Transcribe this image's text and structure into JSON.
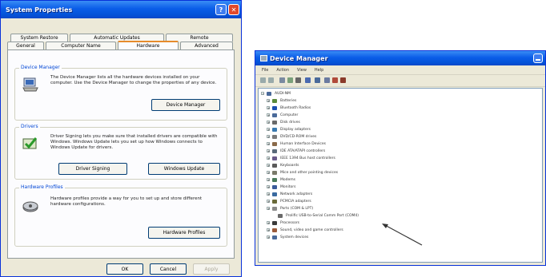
{
  "system_properties": {
    "title": "System Properties",
    "help_glyph": "?",
    "close_glyph": "✕",
    "tabs_row1": [
      "System Restore",
      "Automatic Updates",
      "Remote"
    ],
    "tabs_row2": [
      "General",
      "Computer Name",
      "Hardware",
      "Advanced"
    ],
    "active_tab": "Hardware",
    "device_manager": {
      "heading": "Device Manager",
      "text": "The Device Manager lists all the hardware devices installed on your computer. Use the Device Manager to change the properties of any device.",
      "button": "Device Manager",
      "icon": "computer-icon"
    },
    "drivers": {
      "heading": "Drivers",
      "text": "Driver Signing lets you make sure that installed drivers are compatible with Windows. Windows Update lets you set up how Windows connects to Windows Update for drivers.",
      "button_signing": "Driver Signing",
      "button_update": "Windows Update",
      "icon": "driver-check-icon"
    },
    "hardware_profiles": {
      "heading": "Hardware Profiles",
      "text": "Hardware profiles provide a way for you to set up and store different hardware configurations.",
      "button": "Hardware Profiles",
      "icon": "hardware-profile-icon"
    },
    "footer": {
      "ok": "OK",
      "cancel": "Cancel",
      "apply": "Apply"
    }
  },
  "device_manager_window": {
    "title": "Device Manager",
    "menu": [
      "File",
      "Action",
      "View",
      "Help"
    ],
    "toolbar_icons": [
      "back-icon",
      "forward-icon",
      "properties-icon",
      "refresh-icon",
      "print-icon",
      "help-icon",
      "scan-icon",
      "update-icon",
      "uninstall-icon",
      "disable-icon"
    ],
    "root": "AUDI-NM",
    "tree": [
      {
        "label": "Batteries",
        "color": "#5a8a3a"
      },
      {
        "label": "Bluetooth Radios",
        "color": "#1c4fb0"
      },
      {
        "label": "Computer",
        "color": "#4a6a9a"
      },
      {
        "label": "Disk drives",
        "color": "#6a6a6a"
      },
      {
        "label": "Display adapters",
        "color": "#3a7ab0"
      },
      {
        "label": "DVD/CD-ROM drives",
        "color": "#7a7a7a"
      },
      {
        "label": "Human Interface Devices",
        "color": "#8a6a4a"
      },
      {
        "label": "IDE ATA/ATAPI controllers",
        "color": "#5a6a7a"
      },
      {
        "label": "IEEE 1394 Bus host controllers",
        "color": "#6a5a8a"
      },
      {
        "label": "Keyboards",
        "color": "#5a5a5a"
      },
      {
        "label": "Mice and other pointing devices",
        "color": "#7a7a6a"
      },
      {
        "label": "Modems",
        "color": "#4a7a5a"
      },
      {
        "label": "Monitors",
        "color": "#3a5a9a"
      },
      {
        "label": "Network adapters",
        "color": "#3a6aa0"
      },
      {
        "label": "PCMCIA adapters",
        "color": "#6a6a3a"
      },
      {
        "label": "Ports (COM & LPT)",
        "color": "#8a8a8a"
      },
      {
        "label": "Prolific USB-to-Serial Comm Port (COM4)",
        "color": "#6a6a6a",
        "child": true
      },
      {
        "label": "Processors",
        "color": "#3a3a3a"
      },
      {
        "label": "Sound, video and game controllers",
        "color": "#9a5a3a"
      },
      {
        "label": "System devices",
        "color": "#4a6a9a"
      }
    ]
  }
}
